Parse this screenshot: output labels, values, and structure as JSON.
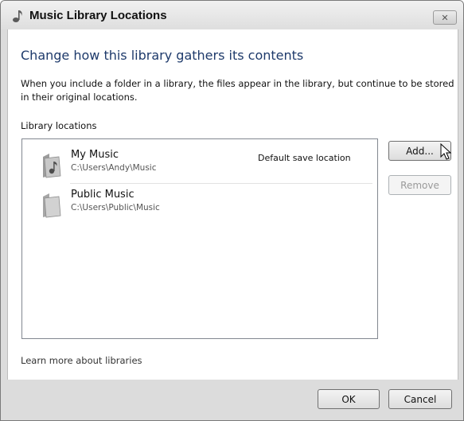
{
  "window": {
    "title": "Music Library Locations",
    "close_label": "✕",
    "icon": "music-note-icon"
  },
  "content": {
    "heading": "Change how this library gathers its contents",
    "description": "When you include a folder in a library, the files appear in the library, but continue to be stored in their original locations.",
    "locations_label": "Library locations",
    "locations": [
      {
        "name": "My Music",
        "path": "C:\\Users\\Andy\\Music",
        "note": "Default save location",
        "icon": "music-folder-icon"
      },
      {
        "name": "Public Music",
        "path": "C:\\Users\\Public\\Music",
        "note": "",
        "icon": "folder-icon"
      }
    ],
    "add_label": "Add...",
    "remove_label": "Remove",
    "learn_more": "Learn more about libraries"
  },
  "footer": {
    "ok_label": "OK",
    "cancel_label": "Cancel"
  }
}
